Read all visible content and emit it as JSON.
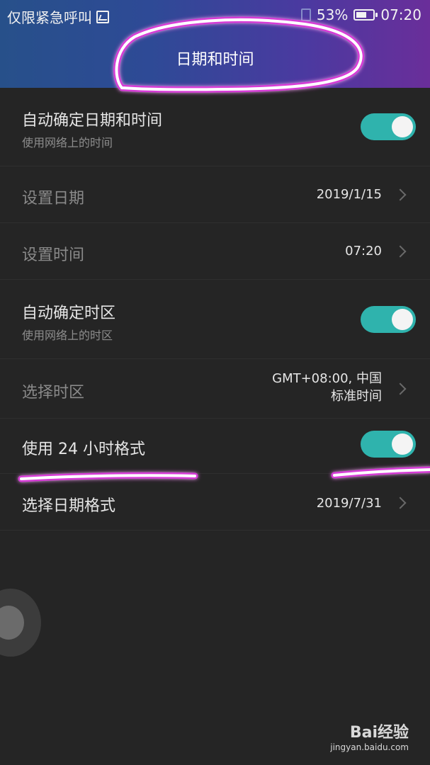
{
  "status_bar": {
    "carrier": "仅限紧急呼叫",
    "battery": "53%",
    "time": "07:20"
  },
  "header": {
    "title": "日期和时间"
  },
  "settings": [
    {
      "label": "自动确定日期和时间",
      "sub": "使用网络上的时间",
      "toggle": "on"
    },
    {
      "label": "设置日期",
      "value": "2019/1/15"
    },
    {
      "label": "设置时间",
      "value": "07:20"
    },
    {
      "label": "自动确定时区",
      "sub": "使用网络上的时区",
      "toggle": "on"
    },
    {
      "label": "选择时区",
      "value_line1": "GMT+08:00, 中国",
      "value_line2": "标准时间"
    },
    {
      "label": "使用 24 小时格式",
      "toggle": "on"
    },
    {
      "label": "选择日期格式",
      "value": "2019/7/31"
    }
  ],
  "watermark": {
    "brand": "Bai经验",
    "url": "jingyan.baidu.com"
  },
  "colors": {
    "toggle_on": "#2fb3ad",
    "annotation": "#d63ad6"
  }
}
